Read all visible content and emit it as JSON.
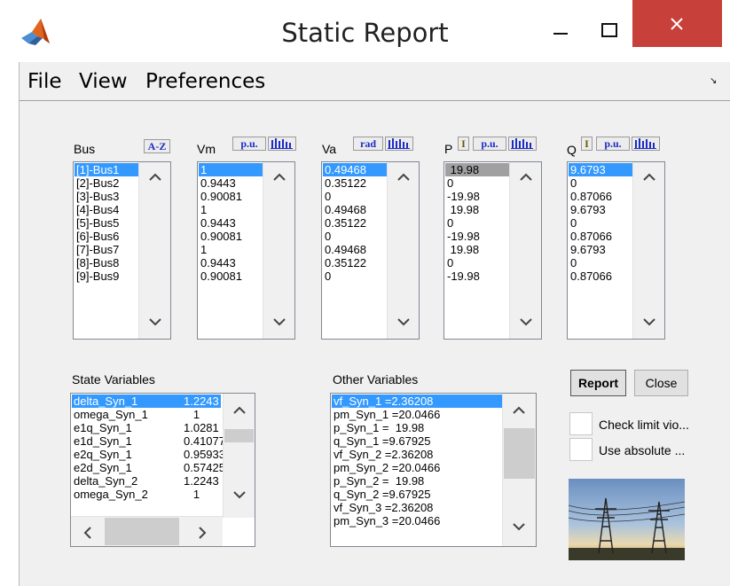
{
  "window": {
    "title": "Static Report"
  },
  "menu": {
    "items": [
      "File",
      "View",
      "Preferences"
    ]
  },
  "columns": {
    "bus": {
      "label": "Bus",
      "sort_button": "A-Z",
      "items": [
        "[1]-Bus1",
        "[2]-Bus2",
        "[3]-Bus3",
        "[4]-Bus4",
        "[5]-Bus5",
        "[6]-Bus6",
        "[7]-Bus7",
        "[8]-Bus8",
        "[9]-Bus9"
      ]
    },
    "vm": {
      "label": "Vm",
      "unit_button": "p.u.",
      "items": [
        "1",
        "0.9443",
        "0.90081",
        "1",
        "0.9443",
        "0.90081",
        "1",
        "0.9443",
        "0.90081"
      ]
    },
    "va": {
      "label": "Va",
      "unit_button": "rad",
      "items": [
        "0.49468",
        "0.35122",
        "0",
        "0.49468",
        "0.35122",
        "0",
        "0.49468",
        "0.35122",
        "0"
      ]
    },
    "p": {
      "label": "P",
      "i_button": "I",
      "unit_button": "p.u.",
      "items": [
        " 19.98",
        "0",
        "-19.98",
        " 19.98",
        "0",
        "-19.98",
        " 19.98",
        "0",
        "-19.98"
      ]
    },
    "q": {
      "label": "Q",
      "i_button": "I",
      "unit_button": "p.u.",
      "items": [
        "9.6793",
        "0",
        "0.87066",
        "9.6793",
        "0",
        "0.87066",
        "9.6793",
        "0",
        "0.87066"
      ]
    }
  },
  "state_variables": {
    "label": "State Variables",
    "items": [
      {
        "name": "delta_Syn_1",
        "value": "1.2243"
      },
      {
        "name": "omega_Syn_1",
        "value": "   1"
      },
      {
        "name": "e1q_Syn_1",
        "value": "1.0281"
      },
      {
        "name": "e1d_Syn_1",
        "value": "0.41077"
      },
      {
        "name": "e2q_Syn_1",
        "value": "0.95933"
      },
      {
        "name": "e2d_Syn_1",
        "value": "0.57425"
      },
      {
        "name": "delta_Syn_2",
        "value": "1.2243"
      },
      {
        "name": "omega_Syn_2",
        "value": "   1"
      }
    ]
  },
  "other_variables": {
    "label": "Other Variables",
    "items": [
      "vf_Syn_1 =2.36208",
      "pm_Syn_1 =20.0466",
      "p_Syn_1 =  19.98",
      "q_Syn_1 =9.67925",
      "vf_Syn_2 =2.36208",
      "pm_Syn_2 =20.0466",
      "p_Syn_2 =  19.98",
      "q_Syn_2 =9.67925",
      "vf_Syn_3 =2.36208",
      "pm_Syn_3 =20.0466"
    ]
  },
  "buttons": {
    "report": "Report",
    "close": "Close"
  },
  "checkboxes": {
    "limit": "Check limit vio...",
    "absolute": "Use absolute ..."
  },
  "colors": {
    "selection": "#3399ff",
    "close_button": "#c7403a",
    "toggle_text": "#1c2cc8"
  },
  "icons": [
    "matlab-icon",
    "minimize-icon",
    "maximize-icon",
    "close-icon",
    "bar-chart-icon",
    "chevron-up-icon",
    "chevron-down-icon",
    "chevron-left-icon",
    "chevron-right-icon",
    "power-lines-photo"
  ]
}
